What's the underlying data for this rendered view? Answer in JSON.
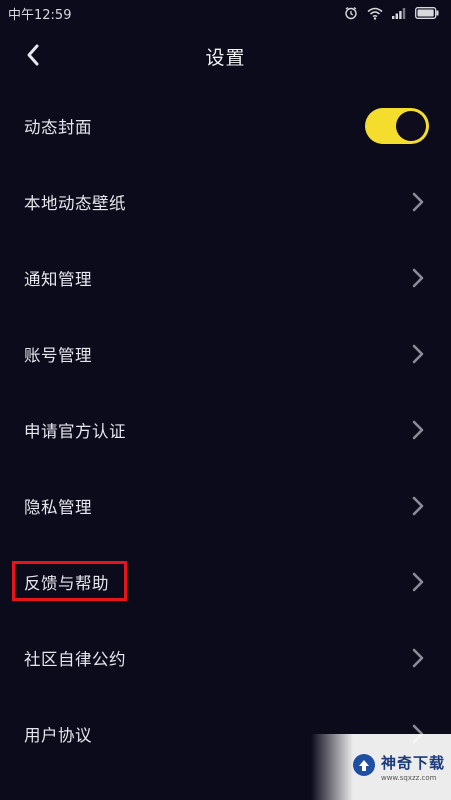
{
  "status_bar": {
    "time": "中午12:59"
  },
  "header": {
    "title": "设置"
  },
  "settings": [
    {
      "label": "动态封面",
      "control": "toggle",
      "toggle_on": true
    },
    {
      "label": "本地动态壁纸",
      "control": "chevron"
    },
    {
      "label": "通知管理",
      "control": "chevron"
    },
    {
      "label": "账号管理",
      "control": "chevron"
    },
    {
      "label": "申请官方认证",
      "control": "chevron"
    },
    {
      "label": "隐私管理",
      "control": "chevron"
    },
    {
      "label": "反馈与帮助",
      "control": "chevron",
      "highlighted": true
    },
    {
      "label": "社区自律公约",
      "control": "chevron"
    },
    {
      "label": "用户协议",
      "control": "chevron"
    }
  ],
  "colors": {
    "background": "#0c0b1b",
    "toggle_on": "#f4dd2c",
    "highlight": "#e8141b"
  },
  "watermark": {
    "title": "神奇下载",
    "url": "www.sqxzz.com"
  }
}
